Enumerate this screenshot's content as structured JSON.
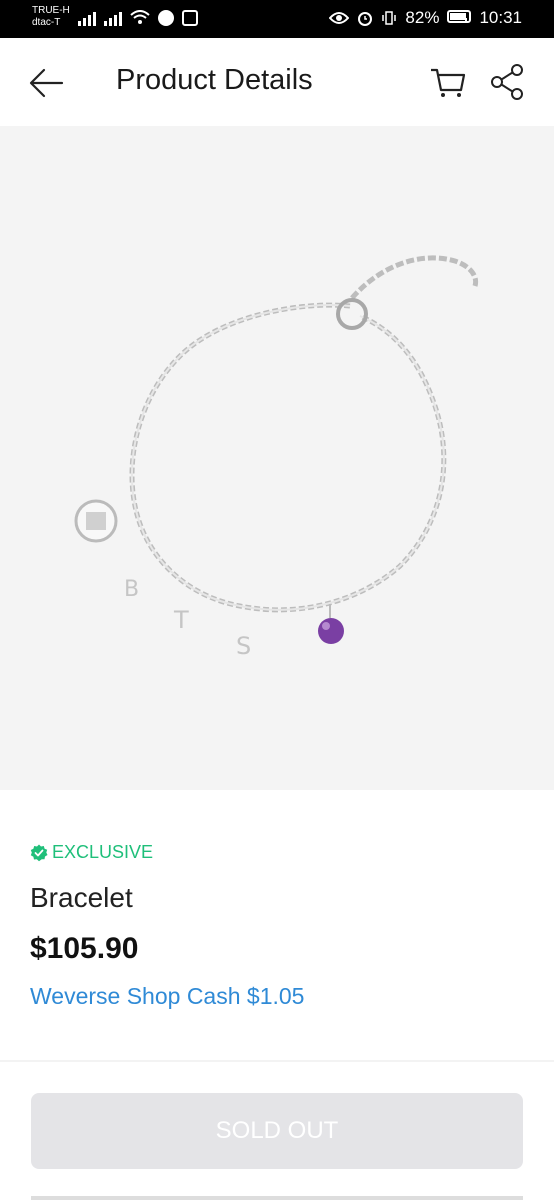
{
  "status_bar": {
    "carrier_1": "TRUE-H",
    "carrier_2": "dtac-T",
    "battery": "82%",
    "time": "10:31",
    "icons": [
      "signal-icon",
      "signal-icon",
      "wifi-icon",
      "line-app-icon",
      "mail-icon",
      "eye-icon",
      "alarm-icon",
      "vibrate-icon",
      "battery-icon"
    ]
  },
  "header": {
    "title": "Product Details",
    "icons": [
      "back-arrow-icon",
      "cart-icon",
      "share-icon"
    ]
  },
  "product": {
    "badge_label": "EXCLUSIVE",
    "name": "Bracelet",
    "price": "$105.90",
    "cash_label": "Weverse Shop Cash $1.05"
  },
  "actions": {
    "sold_out_label": "SOLD OUT"
  },
  "colors": {
    "accent_green": "#1fbf7a",
    "link_blue": "#2f8ad6",
    "disabled_button": "#e4e4e7"
  }
}
